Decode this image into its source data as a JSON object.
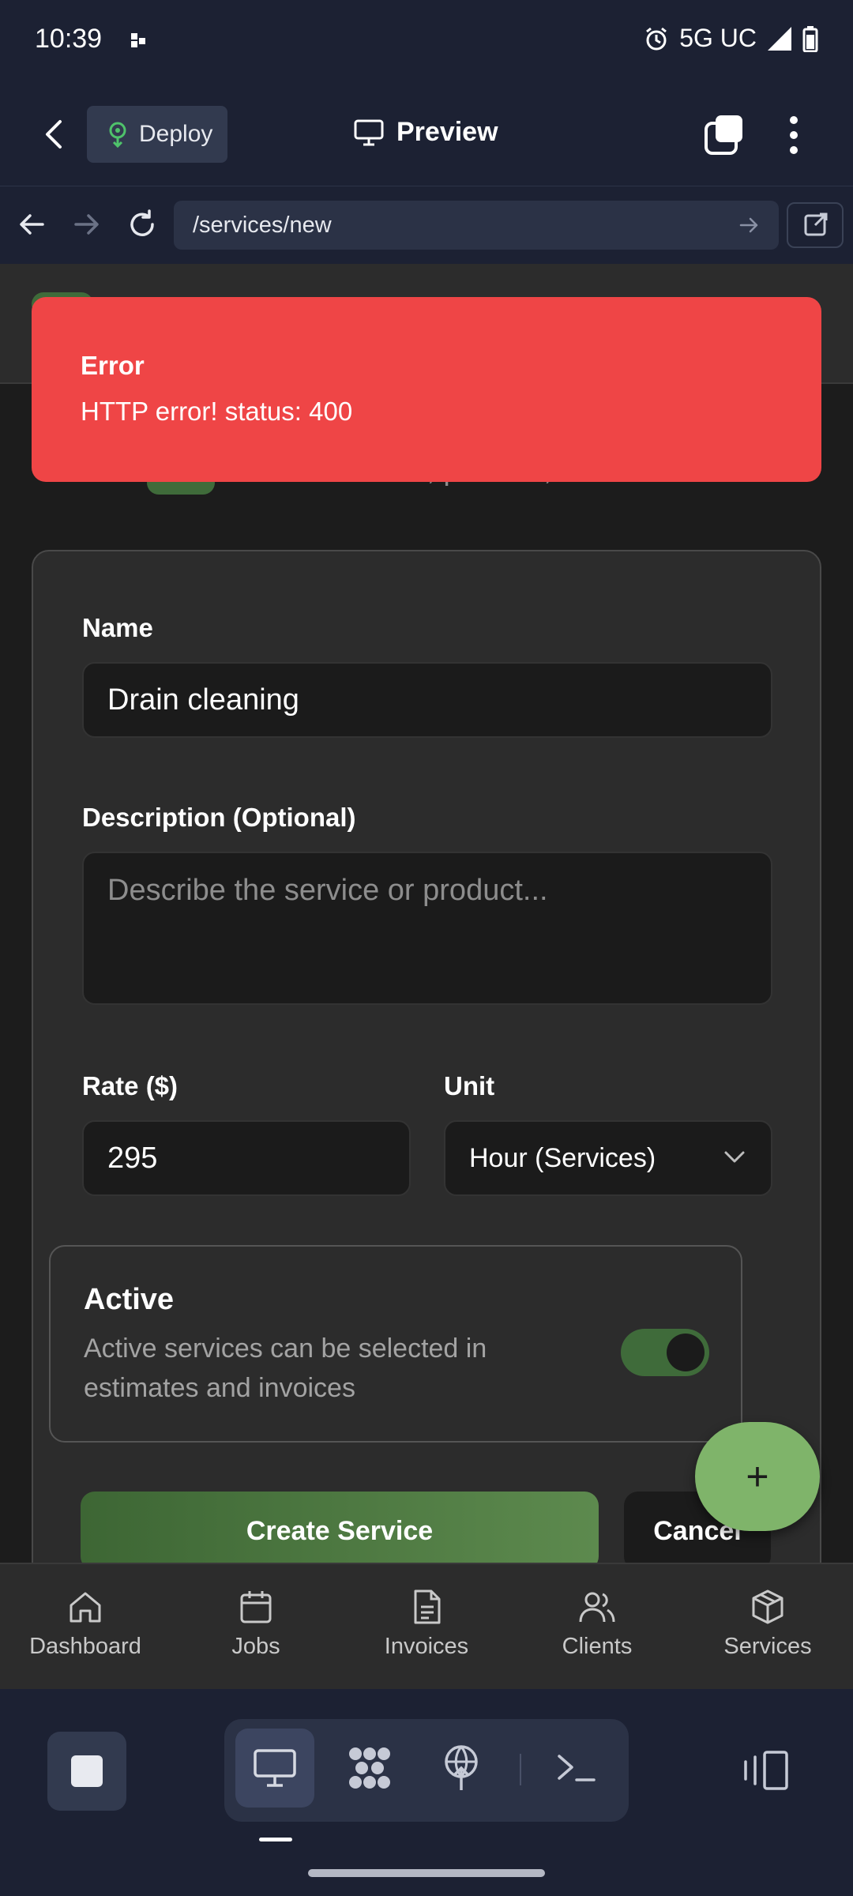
{
  "status_bar": {
    "time": "10:39",
    "network": "5G UC"
  },
  "app_bar": {
    "deploy_label": "Deploy",
    "preview_label": "Preview"
  },
  "url_bar": {
    "url": "/services/new"
  },
  "page": {
    "subtitle": "Add a service, product, or material",
    "form": {
      "name_label": "Name",
      "name_value": "Drain cleaning",
      "description_label": "Description (Optional)",
      "description_placeholder": "Describe the service or product...",
      "rate_label": "Rate ($)",
      "rate_value": "295",
      "unit_label": "Unit",
      "unit_value": "Hour (Services)",
      "active_title": "Active",
      "active_description": "Active services can be selected in estimates and invoices",
      "active_on": true,
      "create_label": "Create Service",
      "cancel_label": "Cancel"
    },
    "fab_label": "+"
  },
  "toast": {
    "title": "Error",
    "message": "HTTP error! status: 400"
  },
  "bottom_nav": [
    {
      "label": "Dashboard",
      "icon": "home-icon"
    },
    {
      "label": "Jobs",
      "icon": "calendar-icon"
    },
    {
      "label": "Invoices",
      "icon": "file-icon"
    },
    {
      "label": "Clients",
      "icon": "users-icon"
    },
    {
      "label": "Services",
      "icon": "box-icon"
    }
  ],
  "colors": {
    "toast_bg": "#ef4546",
    "accent_green": "#5d8a4e",
    "toggle_green": "#3f6b3a",
    "chrome_bg": "#1c2133"
  }
}
